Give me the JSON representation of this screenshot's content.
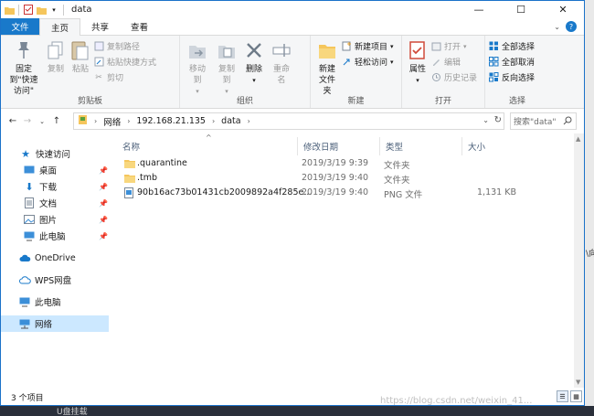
{
  "window": {
    "title": "data",
    "controls": {
      "minimize": "—",
      "maximize": "☐",
      "close": "✕"
    }
  },
  "tabs": {
    "file": "文件",
    "home": "主页",
    "share": "共享",
    "view": "查看",
    "help": "?"
  },
  "ribbon": {
    "clipboard": {
      "name": "剪贴板",
      "pin": "固定到\"快速访问\"",
      "copy": "复制",
      "paste": "粘贴",
      "copy_path": "复制路径",
      "paste_shortcut": "粘贴快捷方式",
      "cut": "剪切"
    },
    "organize": {
      "name": "组织",
      "move_to": "移动到",
      "copy_to": "复制到",
      "delete": "删除",
      "rename": "重命名"
    },
    "new": {
      "name": "新建",
      "new_folder": "新建文件夹",
      "new_item": "新建项目",
      "easy_access": "轻松访问"
    },
    "open": {
      "name": "打开",
      "properties": "属性",
      "open": "打开",
      "edit": "编辑",
      "history": "历史记录"
    },
    "select": {
      "name": "选择",
      "select_all": "全部选择",
      "select_none": "全部取消",
      "invert": "反向选择"
    }
  },
  "address": {
    "crumbs": [
      "网络",
      "192.168.21.135",
      "data"
    ],
    "search_placeholder": "搜索\"data\""
  },
  "nav": {
    "quick_access": "快速访问",
    "desktop": "桌面",
    "downloads": "下载",
    "documents": "文档",
    "pictures": "图片",
    "this_pc_pinned": "此电脑",
    "onedrive": "OneDrive",
    "wps": "WPS网盘",
    "this_pc": "此电脑",
    "network": "网络"
  },
  "columns": {
    "name": "名称",
    "date": "修改日期",
    "type": "类型",
    "size": "大小"
  },
  "files": [
    {
      "name": ".quarantine",
      "date": "2019/3/19 9:39",
      "type": "文件夹",
      "size": "",
      "icon": "folder-icon"
    },
    {
      "name": ".tmb",
      "date": "2019/3/19 9:40",
      "type": "文件夹",
      "size": "",
      "icon": "folder-icon"
    },
    {
      "name": "90b16ac73b01431cb2009892a4f285e...",
      "date": "2019/3/19 9:40",
      "type": "PNG 文件",
      "size": "1,131 KB",
      "icon": "image-file-icon"
    }
  ],
  "status": {
    "count": "3 个项目"
  },
  "watermark": "https://blog.csdn.net/weixin_41...",
  "background": {
    "taskbar_text": "U盘挂载",
    "right_fragment": "\\向"
  },
  "colors": {
    "accent": "#1979ca",
    "selection": "#cce8ff",
    "folder": "#f5c65c"
  }
}
